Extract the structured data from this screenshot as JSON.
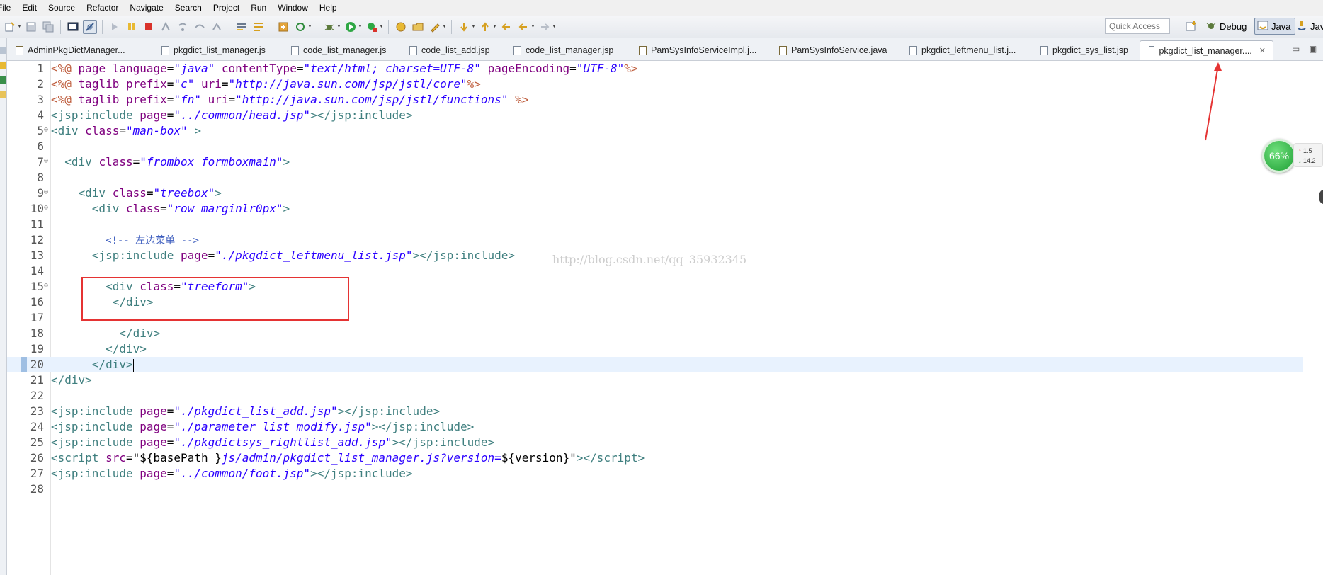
{
  "menubar": {
    "items": [
      "File",
      "Edit",
      "Source",
      "Refactor",
      "Navigate",
      "Search",
      "Project",
      "Run",
      "Window",
      "Help"
    ]
  },
  "toolbar": {
    "quick_access_placeholder": "Quick Access",
    "perspectives": [
      {
        "label": "Debug",
        "icon": "bug-icon"
      },
      {
        "label": "Java",
        "icon": "java-perspective-icon"
      },
      {
        "label": "Jav",
        "icon": "java-ee-icon"
      }
    ]
  },
  "tabs": [
    {
      "label": "AdminPkgDictManager...",
      "type": "java"
    },
    {
      "label": "pkgdict_list_manager.js",
      "type": "js"
    },
    {
      "label": "code_list_manager.js",
      "type": "js"
    },
    {
      "label": "code_list_add.jsp",
      "type": "jsp"
    },
    {
      "label": "code_list_manager.jsp",
      "type": "jsp"
    },
    {
      "label": "PamSysInfoServiceImpl.j...",
      "type": "java"
    },
    {
      "label": "PamSysInfoService.java",
      "type": "java"
    },
    {
      "label": "pkgdict_leftmenu_list.j...",
      "type": "jsp"
    },
    {
      "label": "pkgdict_sys_list.jsp",
      "type": "jsp"
    },
    {
      "label": "pkgdict_list_manager....",
      "type": "jsp",
      "active": true
    }
  ],
  "editor": {
    "current_line": 20,
    "watermark": "http://blog.csdn.net/qq_35932345",
    "line_numbers": [
      "1",
      "2",
      "3",
      "4",
      "5",
      "6",
      "7",
      "8",
      "9",
      "10",
      "11",
      "12",
      "13",
      "14",
      "15",
      "16",
      "17",
      "18",
      "19",
      "20",
      "21",
      "22",
      "23",
      "24",
      "25",
      "26",
      "27",
      "28"
    ]
  },
  "overlay": {
    "network_percent": "66%",
    "upload": "1.5",
    "download": "14.2"
  },
  "colors": {
    "tag": "#3f7f7f",
    "attribute": "#7f007f",
    "string": "#2a00ff",
    "jsp_directive": "#bf5f3f",
    "comment": "#3f5fbf",
    "highlight_box": "#e53333"
  }
}
